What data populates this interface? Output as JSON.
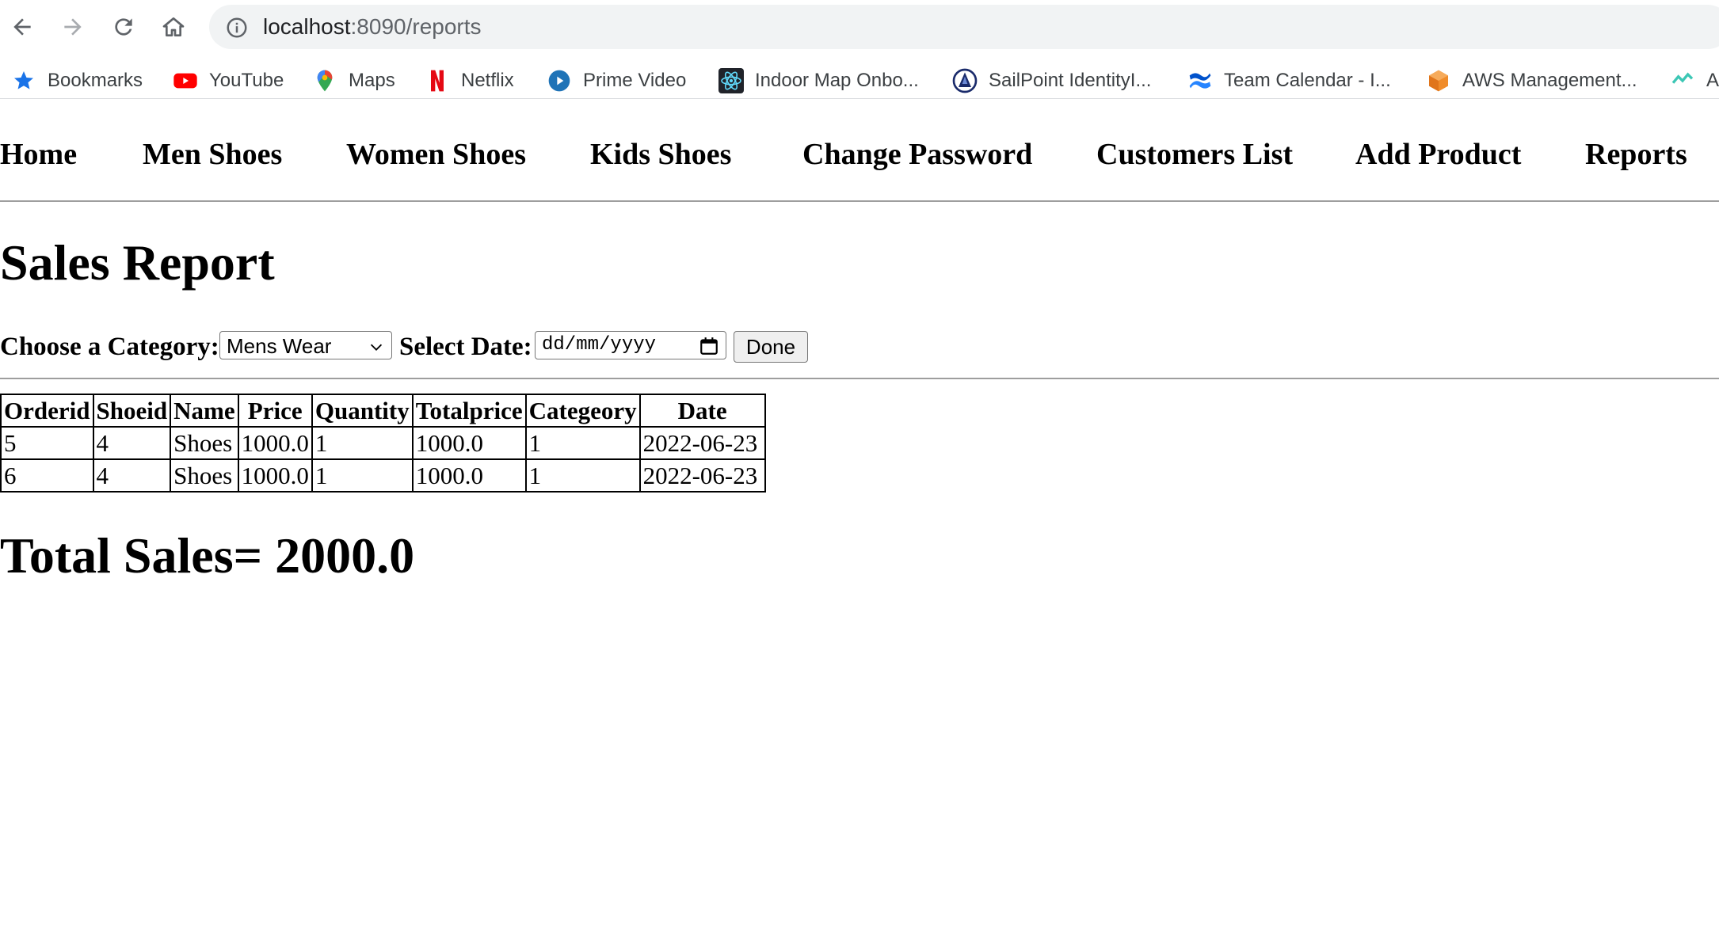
{
  "browser": {
    "url_host": "localhost",
    "url_path": ":8090/reports",
    "bookmarks": [
      {
        "label": "Bookmarks",
        "icon": "star-icon"
      },
      {
        "label": "YouTube",
        "icon": "youtube-icon"
      },
      {
        "label": "Maps",
        "icon": "maps-icon"
      },
      {
        "label": "Netflix",
        "icon": "netflix-icon"
      },
      {
        "label": "Prime Video",
        "icon": "prime-video-icon"
      },
      {
        "label": "Indoor Map Onbo...",
        "icon": "react-icon"
      },
      {
        "label": "SailPoint IdentityI...",
        "icon": "sailpoint-icon"
      },
      {
        "label": "Team Calendar - I...",
        "icon": "confluence-icon"
      },
      {
        "label": "AWS Management...",
        "icon": "aws-icon"
      },
      {
        "label": "A",
        "icon": "bookmark-icon"
      }
    ]
  },
  "nav": {
    "items": [
      "Home",
      "Men Shoes",
      "Women Shoes",
      "Kids Shoes",
      "Change Password",
      "Customers List",
      "Add Product",
      "Reports"
    ]
  },
  "page": {
    "title": "Sales Report",
    "category_label": "Choose a Category:",
    "category_value": "Mens Wear",
    "date_label": "Select Date:",
    "date_placeholder": "dd/mm/yyyy",
    "done_label": "Done",
    "total_text": "Total Sales= 2000.0"
  },
  "table": {
    "headers": [
      "Orderid",
      "Shoeid",
      "Name",
      "Price",
      "Quantity",
      "Totalprice",
      "Categeory",
      "Date"
    ],
    "rows": [
      [
        "5",
        "4",
        "Shoes",
        "1000.0",
        "1",
        "1000.0",
        "1",
        "2022-06-23"
      ],
      [
        "6",
        "4",
        "Shoes",
        "1000.0",
        "1",
        "1000.0",
        "1",
        "2022-06-23"
      ]
    ]
  }
}
